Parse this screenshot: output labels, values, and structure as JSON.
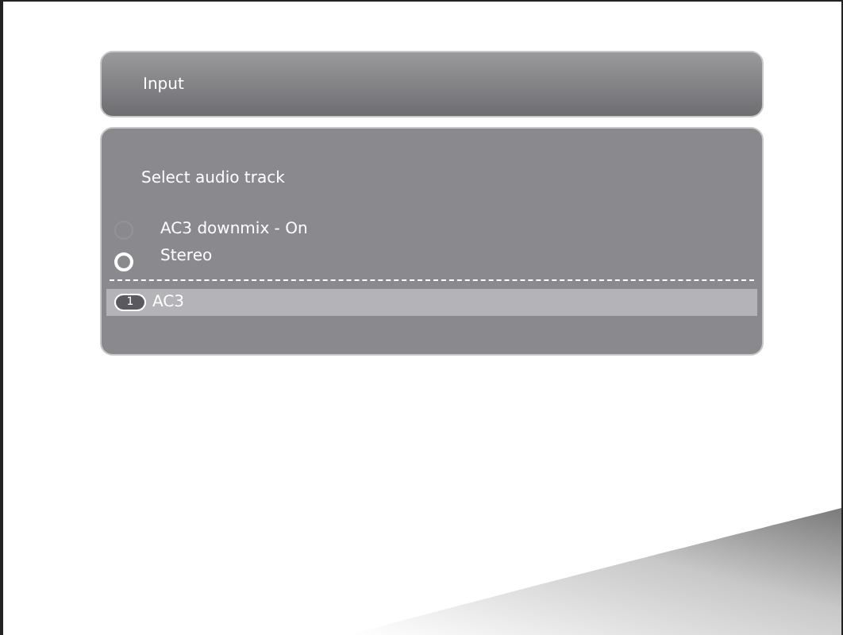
{
  "header": {
    "title": "Input"
  },
  "panel": {
    "heading": "Select audio track",
    "options": [
      {
        "label": "AC3 downmix - On",
        "highlighted": false
      },
      {
        "label": "Stereo",
        "highlighted": true
      }
    ],
    "tracks": [
      {
        "number": "1",
        "label": "AC3",
        "selected": true
      }
    ]
  }
}
